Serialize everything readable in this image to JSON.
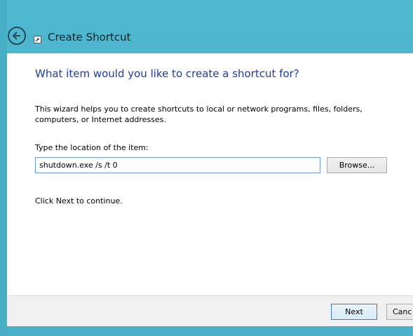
{
  "window": {
    "title": "Create Shortcut",
    "accent_color": "#4fb8d0",
    "heading_color": "#1f3d9a"
  },
  "wizard": {
    "heading": "What item would you like to create a shortcut for?",
    "description": "This wizard helps you to create shortcuts to local or network programs, files, folders, computers, or Internet addresses.",
    "location_label": "Type the location of the item:",
    "location_value": "shutdown.exe /s /t 0",
    "browse_label": "Browse...",
    "continue_hint": "Click Next to continue."
  },
  "footer": {
    "next_label": "Next",
    "cancel_label": "Canc"
  },
  "icons": {
    "back": "back-arrow-icon",
    "app": "shortcut-icon"
  }
}
